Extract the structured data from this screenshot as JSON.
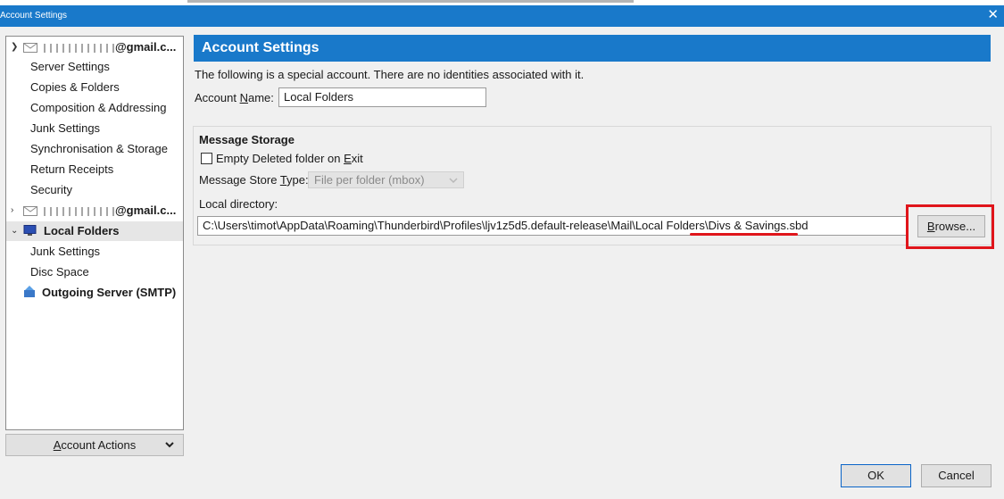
{
  "window": {
    "title": "Account Settings",
    "close_glyph": "✕"
  },
  "tree": {
    "account1": {
      "email_suffix": "@gmail.c..."
    },
    "account1_items": [
      "Server Settings",
      "Copies & Folders",
      "Composition & Addressing",
      "Junk Settings",
      "Synchronisation & Storage",
      "Return Receipts",
      "Security"
    ],
    "account2": {
      "email_suffix": "@gmail.c..."
    },
    "local_folders": {
      "label": "Local Folders",
      "items": [
        "Junk Settings",
        "Disc Space"
      ]
    },
    "outgoing": {
      "label": "Outgoing Server (SMTP)"
    }
  },
  "account_actions": {
    "label_pre": "",
    "label_ul": "A",
    "label_post": "ccount Actions"
  },
  "main": {
    "header": "Account Settings",
    "description": "The following is a special account. There are no identities associated with it.",
    "account_name_label": {
      "pre": "Account ",
      "ul": "N",
      "post": "ame:"
    },
    "account_name_value": "Local Folders",
    "message_storage": {
      "title": "Message Storage",
      "empty_deleted": {
        "pre": "Empty Deleted folder on ",
        "ul": "E",
        "post": "xit",
        "checked": false
      },
      "store_type_label": {
        "pre": "Message Store ",
        "ul": "T",
        "post": "ype:"
      },
      "store_type_value": "File per folder (mbox)",
      "local_dir_label": "Local directory:",
      "local_dir_value": "C:\\Users\\timot\\AppData\\Roaming\\Thunderbird\\Profiles\\ljv1z5d5.default-release\\Mail\\Local Folders\\Divs & Savings.sbd",
      "browse": {
        "ul": "B",
        "post": "rowse..."
      }
    }
  },
  "buttons": {
    "ok": "OK",
    "cancel": "Cancel"
  },
  "colors": {
    "accent": "#1979ca",
    "annotation_red": "#e0151b"
  }
}
